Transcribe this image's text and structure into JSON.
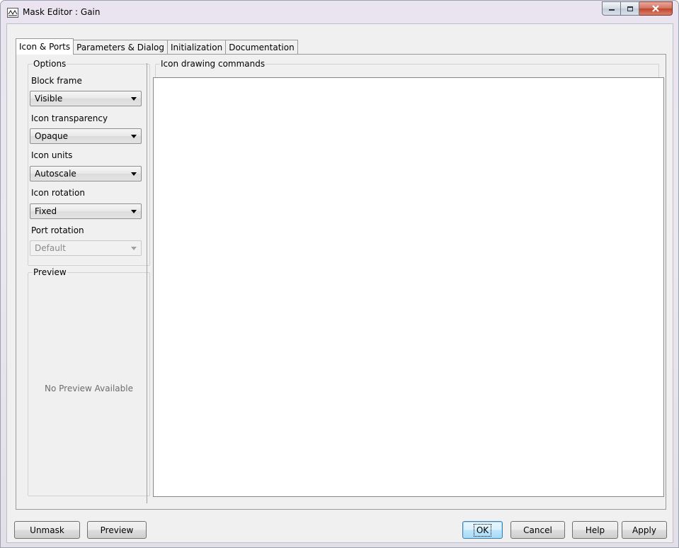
{
  "window": {
    "title": "Mask Editor : Gain",
    "controls": {
      "minimize": "minimize",
      "maximize": "maximize",
      "close": "X"
    }
  },
  "tabs": [
    {
      "label": "Icon & Ports",
      "active": true
    },
    {
      "label": "Parameters & Dialog",
      "active": false
    },
    {
      "label": "Initialization",
      "active": false
    },
    {
      "label": "Documentation",
      "active": false
    }
  ],
  "options": {
    "legend": "Options",
    "block_frame": {
      "label": "Block frame",
      "value": "Visible"
    },
    "icon_transparency": {
      "label": "Icon transparency",
      "value": "Opaque"
    },
    "icon_units": {
      "label": "Icon units",
      "value": "Autoscale"
    },
    "icon_rotation": {
      "label": "Icon rotation",
      "value": "Fixed"
    },
    "port_rotation": {
      "label": "Port rotation",
      "value": "Default",
      "disabled": true
    }
  },
  "preview": {
    "legend": "Preview",
    "message": "No Preview Available"
  },
  "icon_drawing": {
    "legend": "Icon drawing commands",
    "value": ""
  },
  "buttons": {
    "unmask": "Unmask",
    "preview": "Preview",
    "ok": "OK",
    "cancel": "Cancel",
    "help": "Help",
    "apply": "Apply"
  },
  "colors": {
    "close_button": "#c0442b",
    "window_frame": "#e9e4ef",
    "default_button": "#bee6fd"
  }
}
